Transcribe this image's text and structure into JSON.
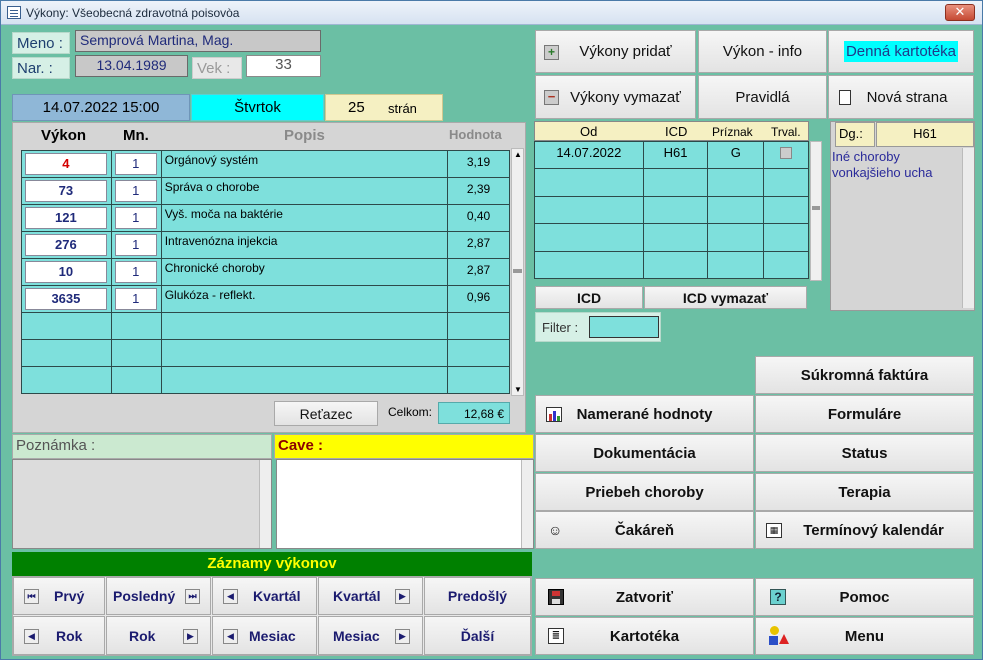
{
  "window": {
    "title": "Výkony: Všeobecná zdravotná poisovòa"
  },
  "patient": {
    "name_label": "Meno :",
    "name_value": "Semprová Martina, Mag.",
    "birth_label": "Nar. :",
    "birth_value": "13.04.1989",
    "age_label": "Vek :",
    "age_value": "33"
  },
  "dateinfo": {
    "datetime": "14.07.2022 15:00",
    "weekday": "Štvrtok",
    "pages_count": "25",
    "pages_label": "strán"
  },
  "table": {
    "headers": {
      "code": "Výkon",
      "qty": "Mn.",
      "desc": "Popis",
      "value": "Hodnota"
    },
    "rows": [
      {
        "code": "4",
        "qty": "1",
        "desc": "Orgánový systém",
        "value": "3,19"
      },
      {
        "code": "73",
        "qty": "1",
        "desc": "Správa o chorobe",
        "value": "2,39"
      },
      {
        "code": "121",
        "qty": "1",
        "desc": "Vyš. moča na baktérie",
        "value": "0,40"
      },
      {
        "code": "276",
        "qty": "1",
        "desc": "Intravenózna injekcia",
        "value": "2,87"
      },
      {
        "code": "10",
        "qty": "1",
        "desc": "Chronické choroby",
        "value": "2,87"
      },
      {
        "code": "3635",
        "qty": "1",
        "desc": "Glukóza - reflekt.",
        "value": "0,96"
      }
    ],
    "retazec": "Reťazec",
    "total_label": "Celkom:",
    "total_value": "12,68 €"
  },
  "notes": {
    "poznamka_label": "Poznámka :",
    "cave_label": "Cave :"
  },
  "records": {
    "title": "Záznamy výkonov",
    "first": "Prvý",
    "last": "Posledný",
    "quarter_prev": "Kvartál",
    "quarter_next": "Kvartál",
    "previous": "Predošlý",
    "year_prev": "Rok",
    "year_next": "Rok",
    "month_prev": "Mesiac",
    "month_next": "Mesiac",
    "next": "Ďalší"
  },
  "topbuttons": {
    "add": "Výkony pridať",
    "info": "Výkon - info",
    "card": "Denná kartotéka",
    "remove": "Výkony vymazať",
    "rules": "Pravidlá",
    "newpage": "Nová strana"
  },
  "icd": {
    "headers": {
      "od": "Od",
      "icd": "ICD",
      "priznak": "Príznak",
      "trval": "Trval."
    },
    "rows": [
      {
        "od": "14.07.2022",
        "icd": "H61",
        "priznak": "G"
      }
    ],
    "icd_button": "ICD",
    "icd_delete": "ICD vymazať",
    "filter_label": "Filter :"
  },
  "dg": {
    "label": "Dg.:",
    "code": "H61",
    "text": "Iné choroby vonkajšieho ucha"
  },
  "actions": {
    "private_invoice": "Súkromná faktúra",
    "measured": "Namerané hodnoty",
    "forms": "Formuláre",
    "documentation": "Dokumentácia",
    "status": "Status",
    "disease_course": "Priebeh choroby",
    "therapy": "Terapia",
    "waiting": "Čakáreň",
    "calendar": "Termínový kalendár",
    "close": "Zatvoriť",
    "help": "Pomoc",
    "cardfile": "Kartotéka",
    "menu": "Menu"
  },
  "colors": {
    "background": "#6bbfa4",
    "grid": "#7ee0dc",
    "cave": "#ffff00",
    "records_header": "#008000",
    "weekday": "#00ffff"
  },
  "icons": [
    "app-icon",
    "plus-icon",
    "minus-icon",
    "page-icon",
    "chart-icon",
    "person-icon",
    "calendar-icon",
    "disk-icon",
    "question-icon",
    "cardfile-icon",
    "menu-icon",
    "first-icon",
    "last-icon",
    "prev-icon",
    "next-icon"
  ]
}
